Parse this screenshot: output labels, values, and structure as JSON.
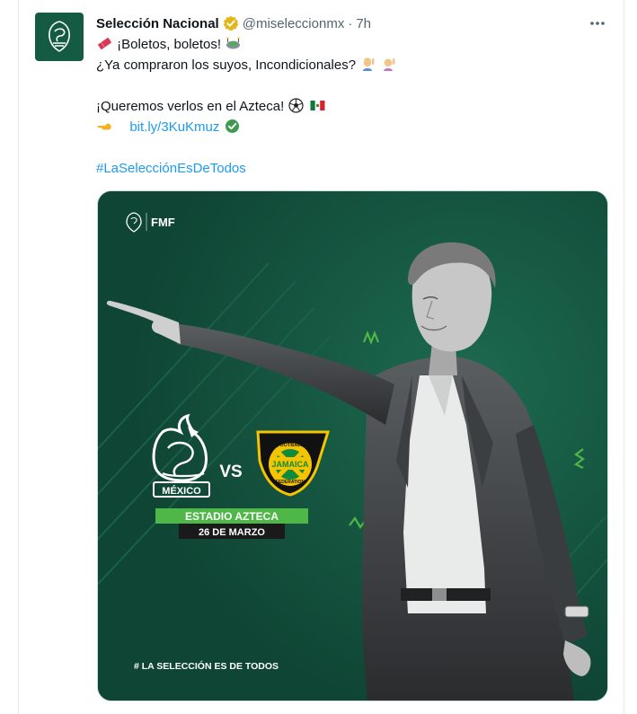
{
  "account": {
    "display_name": "Selección Nacional",
    "handle": "@miseleccionmx",
    "separator": "·",
    "time": "7h"
  },
  "menu": {
    "more_label": "···"
  },
  "tweet": {
    "line1": "¡Boletos, boletos!",
    "line2": "¿Ya compraron los suyos, Incondicionales?",
    "line3": "¡Queremos verlos en el Azteca!",
    "link": "bit.ly/3KuKmuz",
    "hashtag": "#LaSelecciónEsDeTodos"
  },
  "icons": {
    "verified": "verified-badge-icon",
    "ticket": "ticket-emoji-icon",
    "stadium": "stadium-emoji-icon",
    "raising_hand": "raising-hand-emoji-icon",
    "soccer_ball": "soccer-ball-emoji-icon",
    "mexico_flag": "mexico-flag-emoji-icon",
    "pointing_hand": "pointing-hand-emoji-icon",
    "link_check": "link-verified-check-icon"
  },
  "poster": {
    "fmf_label": "FMF",
    "team_home": "MÉXICO",
    "vs_label": "VS",
    "team_away_top": "FOOTBALL",
    "team_away": "JAMAICA",
    "team_away_bottom": "FEDERATION",
    "venue": "ESTADIO AZTECA",
    "date": "26 DE MARZO",
    "slogan": "# LA SELECCIÓN ES DE TODOS"
  },
  "colors": {
    "link": "#1d9bf0",
    "poster_bg": "#16523f",
    "poster_green": "#4fb648",
    "jamaica_yellow": "#f5c400"
  }
}
